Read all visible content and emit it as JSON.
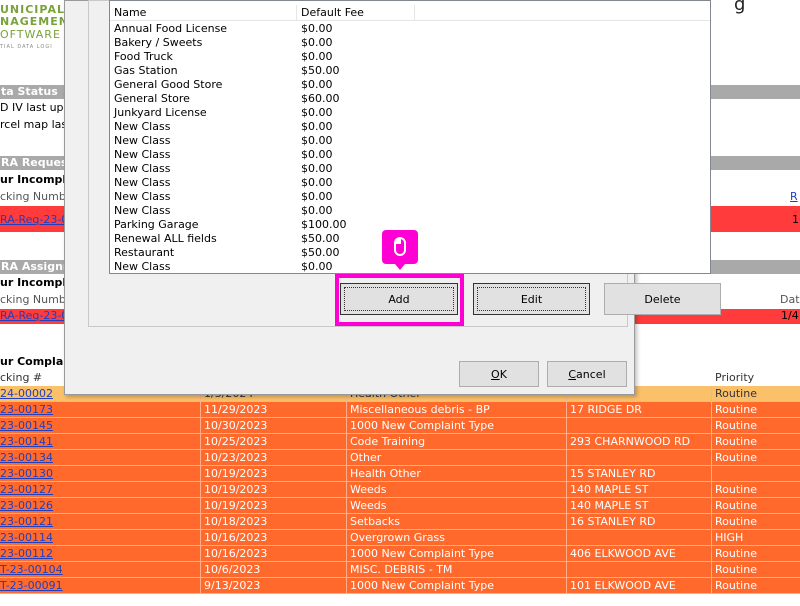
{
  "logo": {
    "line1": "UNICIPAL",
    "line2": "NAGEMENT",
    "line3": "OFTWARE",
    "tagline": "TIAL DATA LOGI"
  },
  "title_fragment": "g",
  "background": {
    "data_status": {
      "header": "ta Status",
      "lines": [
        "D IV last upd",
        "rcel map last u"
      ]
    },
    "ra_requests": {
      "header": "RA Requests",
      "incomplete_label": "ur Incompl",
      "tracking_label": "cking Number",
      "right_link": "R",
      "row_link": "RA-Req-23-0",
      "row_value": "1"
    },
    "ra_assignments": {
      "header": "RA Assignme",
      "incomplete_label": "ur Incompl",
      "tracking_label": "cking Numbe",
      "date_label": "Dat",
      "row_link": "RA-Req-23-0",
      "row_date": "1/4"
    },
    "complaints": {
      "section_label": "ur Complai",
      "columns": [
        "cking #",
        "",
        "",
        "",
        "Priority"
      ],
      "rows": [
        [
          "24-00002",
          "1/3/2024",
          "Health Other",
          "",
          "Routine"
        ],
        [
          "23-00173",
          "11/29/2023",
          "Miscellaneous debris - BP",
          "17 RIDGE DR",
          "Routine"
        ],
        [
          "23-00145",
          "10/30/2023",
          "1000 New Complaint Type",
          "",
          "Routine"
        ],
        [
          "23-00141",
          "10/25/2023",
          "Code Training",
          "293 CHARNWOOD RD",
          "Routine"
        ],
        [
          "23-00134",
          "10/23/2023",
          "Other",
          "",
          "Routine"
        ],
        [
          "23-00130",
          "10/19/2023",
          "Health Other",
          "15 STANLEY RD",
          ""
        ],
        [
          "23-00127",
          "10/19/2023",
          "Weeds",
          "140 MAPLE ST",
          "Routine"
        ],
        [
          "23-00126",
          "10/19/2023",
          "Weeds",
          "140 MAPLE ST",
          "Routine"
        ],
        [
          "23-00121",
          "10/18/2023",
          "Setbacks",
          "16 STANLEY RD",
          "Routine"
        ],
        [
          "23-00114",
          "10/16/2023",
          "Overgrown Grass",
          "",
          "HIGH"
        ],
        [
          "23-00112",
          "10/16/2023",
          "1000 New Complaint Type",
          "406 ELKWOOD AVE",
          "Routine"
        ],
        [
          "T-23-00104",
          "10/6/2023",
          "MISC. DEBRIS - TM",
          "",
          "Routine"
        ],
        [
          "T-23-00091",
          "9/13/2023",
          "1000 New Complaint Type",
          "101 ELKWOOD AVE",
          "Routine"
        ]
      ]
    }
  },
  "dialog": {
    "columns": {
      "name": "Name",
      "fee": "Default Fee"
    },
    "items": [
      {
        "name": "Annual Food License",
        "fee": "$0.00"
      },
      {
        "name": "Bakery / Sweets",
        "fee": "$0.00"
      },
      {
        "name": "Food Truck",
        "fee": "$0.00"
      },
      {
        "name": "Gas Station",
        "fee": "$50.00"
      },
      {
        "name": "General Good Store",
        "fee": "$0.00"
      },
      {
        "name": "General Store",
        "fee": "$60.00"
      },
      {
        "name": "Junkyard License",
        "fee": "$0.00"
      },
      {
        "name": "New Class",
        "fee": "$0.00"
      },
      {
        "name": "New Class",
        "fee": "$0.00"
      },
      {
        "name": "New Class",
        "fee": "$0.00"
      },
      {
        "name": "New Class",
        "fee": "$0.00"
      },
      {
        "name": "New Class",
        "fee": "$0.00"
      },
      {
        "name": "New Class",
        "fee": "$0.00"
      },
      {
        "name": "New Class",
        "fee": "$0.00"
      },
      {
        "name": "Parking Garage",
        "fee": "$100.00"
      },
      {
        "name": "Renewal ALL fields",
        "fee": "$50.00"
      },
      {
        "name": "Restaurant",
        "fee": "$50.00"
      },
      {
        "name": "New Class",
        "fee": "$0.00"
      }
    ],
    "buttons": {
      "add": "Add",
      "edit": "Edit",
      "delete": "Delete",
      "ok_mnemonic": "O",
      "ok_rest": "K",
      "cancel_mnemonic": "C",
      "cancel_rest": "ancel"
    }
  },
  "annotation": {
    "highlight_color": "#ff00d4",
    "icon": "mouse-icon"
  },
  "colors": {
    "row_orange": "#ff6a2c",
    "row_first": "#fbc16a",
    "row_red": "#ff3b3b",
    "header_gray": "#a9a9a9"
  }
}
